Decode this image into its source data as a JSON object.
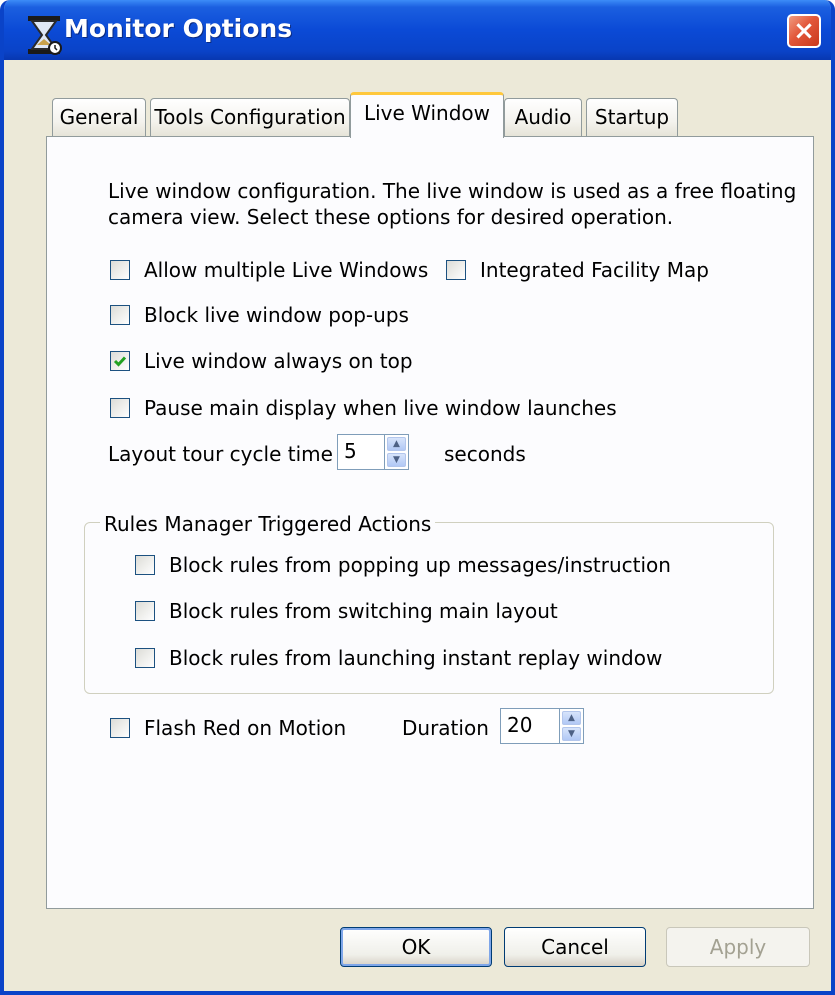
{
  "window": {
    "title": "Monitor Options",
    "close_glyph": "×"
  },
  "tabs": [
    {
      "label": "General"
    },
    {
      "label": "Tools Configuration"
    },
    {
      "label": "Live Window"
    },
    {
      "label": "Audio"
    },
    {
      "label": "Startup"
    }
  ],
  "active_tab": "Live Window",
  "live": {
    "description_line1": "Live window configuration.  The live window is used as a free floating",
    "description_line2": "camera view.  Select these options for desired operation.",
    "allow_multiple": {
      "label": "Allow multiple Live Windows",
      "checked": false
    },
    "integrated_map": {
      "label": "Integrated Facility Map",
      "checked": false
    },
    "block_popups": {
      "label": "Block live window pop-ups",
      "checked": false
    },
    "always_on_top": {
      "label": "Live window always on top",
      "checked": true
    },
    "pause_main": {
      "label": "Pause main display when live window launches",
      "checked": false
    },
    "tour": {
      "label": "Layout tour cycle time",
      "value": "5",
      "unit": "seconds"
    }
  },
  "rules": {
    "legend": "Rules Manager Triggered Actions",
    "block_messages": {
      "label": "Block rules from popping up messages/instruction",
      "checked": false
    },
    "block_switch": {
      "label": "Block rules from switching main layout",
      "checked": false
    },
    "block_replay": {
      "label": "Block rules from launching instant replay window",
      "checked": false
    }
  },
  "flash": {
    "label": "Flash Red on Motion",
    "checked": false,
    "duration_label": "Duration",
    "duration_value": "20"
  },
  "buttons": {
    "ok": "OK",
    "cancel": "Cancel",
    "apply": "Apply"
  },
  "icons": {
    "title": "hourglass-icon",
    "close": "close-icon",
    "check": "checkmark-icon",
    "spin_up": "▲",
    "spin_down": "▼"
  },
  "colors": {
    "title_bar": "#0a43c8",
    "dialog_bg": "#ece9d8",
    "active_tab_accent": "#ffc83c",
    "check_green": "#21a121",
    "close_red": "#e2573a"
  }
}
